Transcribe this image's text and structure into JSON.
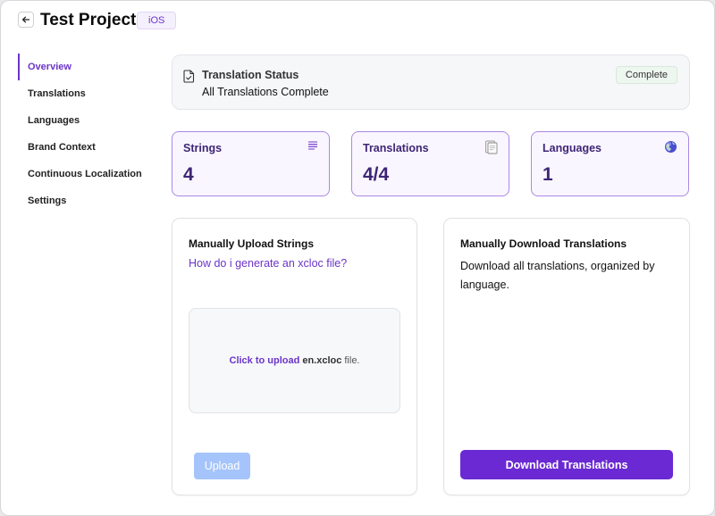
{
  "header": {
    "title": "Test Project",
    "platform_badge": "iOS"
  },
  "sidebar": {
    "items": [
      {
        "label": "Overview",
        "active": true
      },
      {
        "label": "Translations"
      },
      {
        "label": "Languages"
      },
      {
        "label": "Brand Context"
      },
      {
        "label": "Continuous Localization"
      },
      {
        "label": "Settings"
      }
    ]
  },
  "status": {
    "title": "Translation Status",
    "text": "All Translations Complete",
    "badge": "Complete"
  },
  "stats": [
    {
      "label": "Strings",
      "value": "4",
      "icon": "list-icon"
    },
    {
      "label": "Translations",
      "value": "4/4",
      "icon": "document-icon"
    },
    {
      "label": "Languages",
      "value": "1",
      "icon": "globe-icon"
    }
  ],
  "upload_panel": {
    "title": "Manually Upload Strings",
    "help_link": "How do i generate an xcloc file?",
    "dropzone_link": "Click to upload",
    "dropzone_file": "en.xcloc",
    "dropzone_rest": "file.",
    "button": "Upload"
  },
  "download_panel": {
    "title": "Manually Download Translations",
    "description": "Download all translations, organized by language.",
    "button": "Download Translations"
  },
  "colors": {
    "accent": "#6b35c9",
    "primary_button": "#6a29d2",
    "disabled_button": "#a5c4fb",
    "stat_border": "#a98ae3"
  }
}
